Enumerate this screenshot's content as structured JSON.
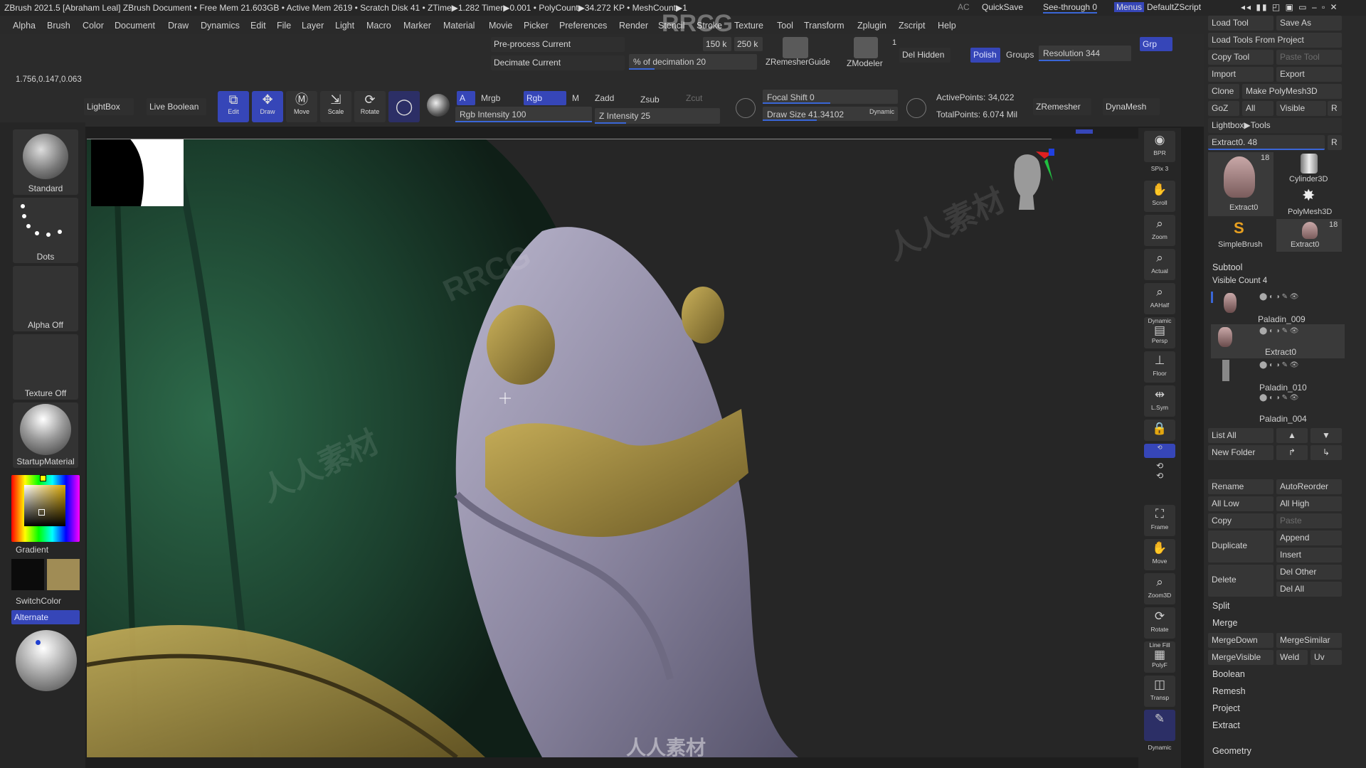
{
  "titlebar": {
    "title": "ZBrush 2021.5 [Abraham Leal]   ZBrush Document      • Free Mem 21.603GB • Active Mem 2619 • Scratch Disk 41 • ZTime▶1.282 Timer▶0.001 • PolyCount▶34.272 KP • MeshCount▶1",
    "ac": "AC",
    "quicksave": "QuickSave",
    "seethrough": "See-through  0",
    "menus": "Menus",
    "script": "DefaultZScript"
  },
  "menubar": [
    "Alpha",
    "Brush",
    "Color",
    "Document",
    "Draw",
    "Dynamics",
    "Edit",
    "File",
    "Layer",
    "Light",
    "Macro",
    "Marker",
    "Material",
    "Movie",
    "Picker",
    "Preferences",
    "Render",
    "Stencil",
    "Stroke",
    "Texture",
    "Tool",
    "Transform",
    "Zplugin",
    "Zscript",
    "Help"
  ],
  "coords": "1.756,0.147,0.063",
  "zremesher_panel": {
    "preprocess": "Pre-process Current",
    "decimate": "Decimate Current",
    "k150": "150 k",
    "k250": "250 k",
    "decimation": "% of decimation 20",
    "zremesher_guide": "ZRemesherGuide",
    "zmodeler": "ZModeler",
    "zmodeler_count": "1",
    "del_hidden": "Del Hidden",
    "polish": "Polish",
    "groups": "Groups",
    "resolution": "Resolution 344",
    "grp": "Grp"
  },
  "toolbar": {
    "lightbox": "LightBox",
    "live_boolean": "Live Boolean",
    "edit": "Edit",
    "draw": "Draw",
    "move": "Move",
    "scale": "Scale",
    "rotate": "Rotate",
    "a": "A",
    "mrgb": "Mrgb",
    "rgb": "Rgb",
    "m": "M",
    "zadd": "Zadd",
    "zsub": "Zsub",
    "zcut": "Zcut",
    "rgb_intensity": "Rgb Intensity 100",
    "z_intensity": "Z Intensity 25",
    "focal_shift": "Focal Shift 0",
    "draw_size": "Draw Size 41.34102",
    "dynamic": "Dynamic",
    "active_points": "ActivePoints: 34,022",
    "total_points": "TotalPoints: 6.074 Mil",
    "zremesher": "ZRemesher",
    "dynamesh": "DynaMesh"
  },
  "leftpanel": {
    "standard": "Standard",
    "dots": "Dots",
    "alpha_off": "Alpha Off",
    "texture_off": "Texture Off",
    "material": "StartupMaterial",
    "gradient": "Gradient",
    "switchcolor": "SwitchColor",
    "alternate": "Alternate"
  },
  "rightbar": [
    {
      "name": "bpr",
      "label": "BPR"
    },
    {
      "name": "spix",
      "label": "SPix 3"
    },
    {
      "name": "scroll",
      "label": "Scroll"
    },
    {
      "name": "zoom",
      "label": "Zoom"
    },
    {
      "name": "actual",
      "label": "Actual"
    },
    {
      "name": "aahalf",
      "label": "AAHalf"
    },
    {
      "name": "persp",
      "label": "Persp"
    },
    {
      "name": "floor",
      "label": "Floor"
    },
    {
      "name": "lsym",
      "label": "L.Sym"
    },
    {
      "name": "frame",
      "label": "Frame"
    },
    {
      "name": "move",
      "label": "Move"
    },
    {
      "name": "zoom3d",
      "label": "Zoom3D"
    },
    {
      "name": "rotate",
      "label": "Rotate"
    },
    {
      "name": "polyf",
      "label": "PolyF"
    },
    {
      "name": "transp",
      "label": "Transp"
    }
  ],
  "rightbar_extra": {
    "dynamic": "Dynamic",
    "line_fill": "Line Fill"
  },
  "tool_tray": {
    "load_tool": "Load Tool",
    "save_as": "Save As",
    "load_from_project": "Load Tools From Project",
    "copy_tool": "Copy Tool",
    "paste_tool": "Paste Tool",
    "import": "Import",
    "export": "Export",
    "clone": "Clone",
    "make_polymesh": "Make PolyMesh3D",
    "goz": "GoZ",
    "all": "All",
    "visible": "Visible",
    "r": "R",
    "lightbox_tools": "Lightbox▶Tools",
    "extract_slider": "Extract0. 48",
    "thumbs": [
      {
        "label": "Extract0",
        "count": "18"
      },
      {
        "label": "Cylinder3D",
        "count": ""
      },
      {
        "label": "PolyMesh3D",
        "count": ""
      },
      {
        "label": "SimpleBrush",
        "count": ""
      },
      {
        "label": "Extract0",
        "count": "18"
      }
    ]
  },
  "subtool": {
    "header": "Subtool",
    "visible_count": "Visible Count 4",
    "items": [
      "Paladin_009",
      "Extract0",
      "Paladin_010",
      "Paladin_004"
    ],
    "list_all": "List All",
    "new_folder": "New Folder",
    "rename": "Rename",
    "autoreorder": "AutoReorder",
    "all_low": "All Low",
    "all_high": "All High",
    "copy": "Copy",
    "paste": "Paste",
    "duplicate": "Duplicate",
    "append": "Append",
    "insert": "Insert",
    "delete": "Delete",
    "del_other": "Del Other",
    "del_all": "Del All",
    "split": "Split",
    "merge": "Merge",
    "mergedown": "MergeDown",
    "mergesimilar": "MergeSimilar",
    "mergevisible": "MergeVisible",
    "weld": "Weld",
    "uv": "Uv",
    "boolean": "Boolean",
    "remesh": "Remesh",
    "project": "Project",
    "extract": "Extract",
    "geometry": "Geometry"
  },
  "watermark": {
    "rrcg": "RRCG",
    "cn": "人人素材"
  },
  "colors": {
    "accent": "#3646b8",
    "panel": "#2b2b2b",
    "viewport_green": "#1f4a34",
    "armor": "#8f8aa3",
    "gold": "#a08c45"
  }
}
